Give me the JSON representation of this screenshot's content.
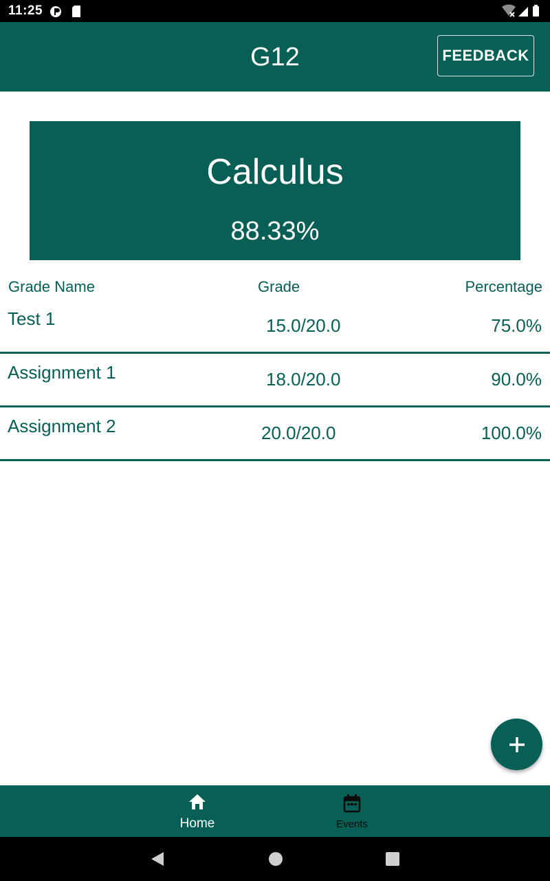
{
  "status_bar": {
    "time": "11:25"
  },
  "app_bar": {
    "title": "G12",
    "feedback_label": "FEEDBACK"
  },
  "course": {
    "name": "Calculus",
    "average": "88.33%"
  },
  "table": {
    "headers": {
      "name": "Grade Name",
      "grade": "Grade",
      "percentage": "Percentage"
    },
    "rows": [
      {
        "name": "Test 1",
        "grade": "15.0/20.0",
        "percentage": "75.0%"
      },
      {
        "name": "Assignment 1",
        "grade": "18.0/20.0",
        "percentage": "90.0%"
      },
      {
        "name": "Assignment 2",
        "grade": "20.0/20.0",
        "percentage": "100.0%"
      }
    ]
  },
  "fab": {
    "icon": "plus-icon"
  },
  "bottom_nav": {
    "items": [
      {
        "label": "Home",
        "icon": "home-icon",
        "active": true
      },
      {
        "label": "Events",
        "icon": "calendar-icon",
        "active": false
      }
    ]
  },
  "colors": {
    "primary": "#075f56",
    "on_primary": "#ffffff",
    "background": "#ffffff",
    "system_bar": "#000000"
  }
}
